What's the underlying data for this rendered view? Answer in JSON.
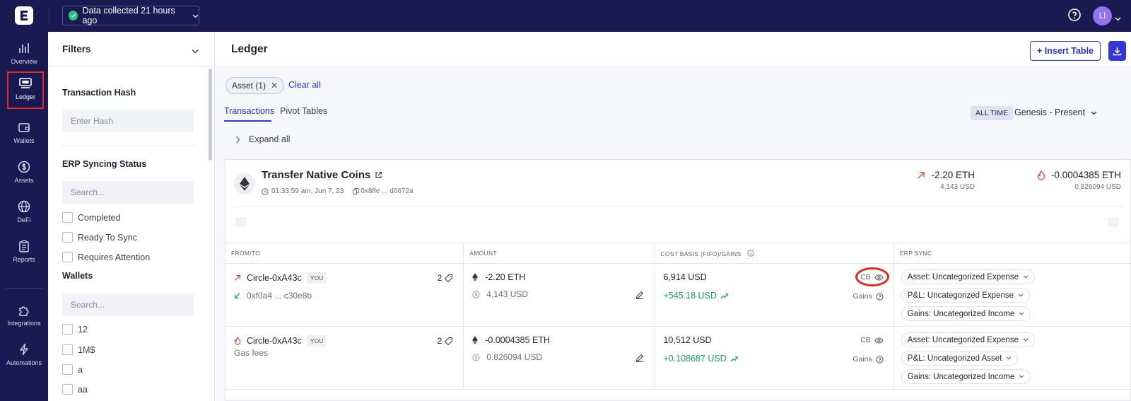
{
  "topbar": {
    "data_status": "Data collected 21 hours ago",
    "avatar_initials": "LI"
  },
  "nav": {
    "items": [
      {
        "label": "Overview",
        "icon": "bar-chart-icon"
      },
      {
        "label": "Ledger",
        "icon": "ledger-icon",
        "active": true
      },
      {
        "label": "Wallets",
        "icon": "wallet-icon"
      },
      {
        "label": "Assets",
        "icon": "dollar-coin-icon"
      },
      {
        "label": "DeFi",
        "icon": "globe-icon"
      },
      {
        "label": "Reports",
        "icon": "clipboard-icon"
      },
      {
        "label": "Integrations",
        "icon": "puzzle-icon"
      },
      {
        "label": "Automations",
        "icon": "lightning-icon"
      }
    ],
    "active_highlight_color": "#e12a1f"
  },
  "filters": {
    "title": "Filters",
    "tx_hash_label": "Transaction Hash",
    "tx_hash_placeholder": "Enter Hash",
    "erp_label": "ERP Syncing Status",
    "erp_search_placeholder": "Search...",
    "erp_options": [
      "Completed",
      "Ready To Sync",
      "Requires Attention"
    ],
    "wallets_label": "Wallets",
    "wallets_search_placeholder": "Search...",
    "wallet_options": [
      "12",
      "1M$",
      "a",
      "aa"
    ]
  },
  "main": {
    "title": "Ledger",
    "insert_table": "+ Insert Table",
    "chip_label": "Asset (1)",
    "clear_all": "Clear all",
    "tabs": [
      "Transactions",
      "Pivot Tables"
    ],
    "time_badge": "ALL TIME",
    "time_range": "Genesis - Present",
    "expand_all": "Expand all",
    "accent": "#3436d9"
  },
  "transaction": {
    "title": "Transfer Native Coins",
    "time": "01:33:59 am, Jun 7, 23",
    "hash": "0x8ffe ... d0672a",
    "out_amount": "-2.20 ETH",
    "out_usd": "4,143 USD",
    "fee_amount": "-0.0004385 ETH",
    "fee_usd": "0.826094 USD"
  },
  "table": {
    "headers": [
      "FROM/TO",
      "AMOUNT",
      "COST BASIS (FIFO)/GAINS",
      "ERP SYNC"
    ],
    "rows": [
      {
        "from": "Circle-0xA43c",
        "you": "YOU",
        "tag_count": "2",
        "to": "0xf0a4 ... c30e8b",
        "amount": "-2.20 ETH",
        "amount_usd": "4,143 USD",
        "cost_basis": "6,914 USD",
        "gain": "+545.18 USD",
        "cb_label": "CB",
        "gains_label": "Gains",
        "erp": [
          "Asset: Uncategorized Expense",
          "P&L: Uncategorized Expense",
          "Gains: Uncategorized Income"
        ]
      },
      {
        "from": "Circle-0xA43c",
        "you": "YOU",
        "tag_count": "2",
        "to": "Gas fees",
        "amount": "-0.0004385 ETH",
        "amount_usd": "0.826094 USD",
        "cost_basis": "10,512 USD",
        "gain": "+0.108687 USD",
        "cb_label": "CB",
        "gains_label": "Gains",
        "erp": [
          "Asset: Uncategorized Expense",
          "P&L: Uncategorized Asset",
          "Gains: Uncategorized Income"
        ]
      }
    ]
  }
}
